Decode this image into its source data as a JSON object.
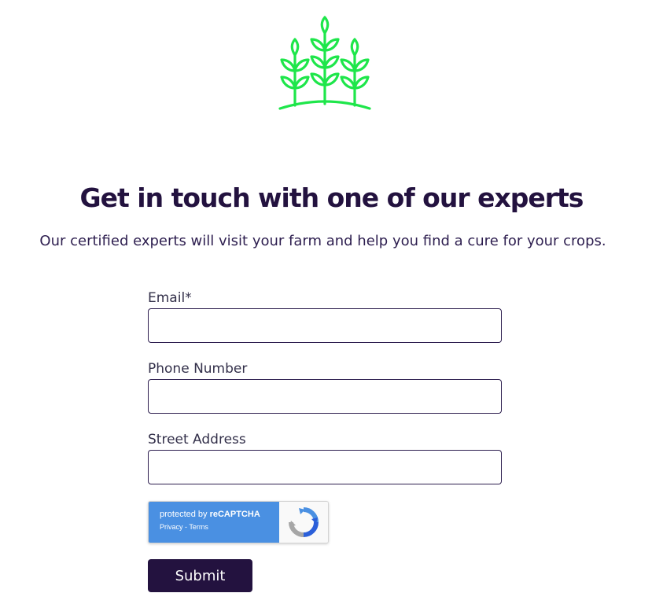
{
  "colors": {
    "brand_dark": "#23123f",
    "logo_green": "#1ee64a",
    "recaptcha_blue": "#4a90e2"
  },
  "logo": {
    "icon": "wheat-plants-icon"
  },
  "hero": {
    "title": "Get in touch with one of our experts",
    "subtitle": "Our certified experts will visit your farm and help you find a cure for your crops."
  },
  "form": {
    "email": {
      "label": "Email*",
      "value": "",
      "placeholder": ""
    },
    "phone": {
      "label": "Phone Number",
      "value": "",
      "placeholder": ""
    },
    "street": {
      "label": "Street Address",
      "value": "",
      "placeholder": ""
    },
    "recaptcha": {
      "prefix": "protected by ",
      "brand": "reCAPTCHA",
      "privacy": "Privacy",
      "separator": " - ",
      "terms": "Terms",
      "icon": "recaptcha-icon"
    },
    "submit_label": "Submit"
  }
}
